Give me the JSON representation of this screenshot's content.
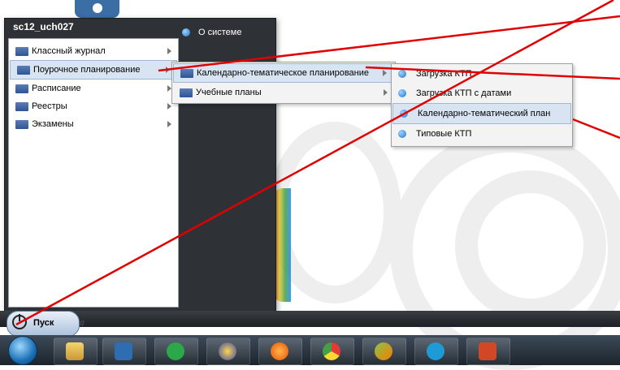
{
  "start_menu": {
    "user": "sc12_uch027",
    "items": [
      {
        "label": "Классный журнал"
      },
      {
        "label": "Поурочное планирование"
      },
      {
        "label": "Расписание"
      },
      {
        "label": "Реестры"
      },
      {
        "label": "Экзамены"
      }
    ],
    "right_item": "О системе"
  },
  "submenu1": [
    {
      "label": "Календарно-тематическое планирование"
    },
    {
      "label": "Учебные планы"
    }
  ],
  "submenu2": [
    {
      "label": "Загрузка КТП"
    },
    {
      "label": "Загрузка КТП с датами"
    },
    {
      "label": "Календарно-тематический план"
    },
    {
      "label": "Типовые КТП"
    }
  ],
  "taskbar": {
    "start_label": "Пуск",
    "hash": "#",
    "icons": [
      "windows-explorer-icon",
      "media-player-icon",
      "mail-agent-icon",
      "app-icon",
      "firefox-icon",
      "chrome-icon",
      "game-icon",
      "skype-icon",
      "powerpoint-icon"
    ]
  },
  "colors": {
    "menu_dark": "#2e3236",
    "highlight": "#d8e4f2",
    "annotation_line": "#e00000"
  }
}
